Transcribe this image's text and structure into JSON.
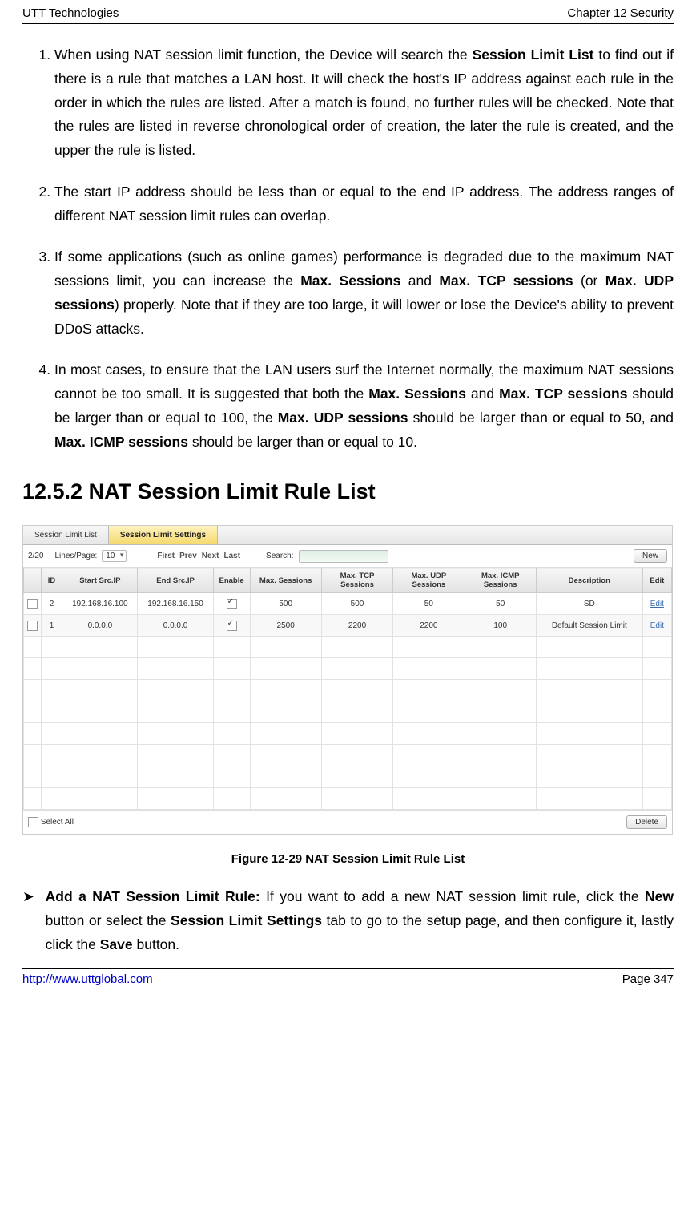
{
  "header": {
    "left": "UTT Technologies",
    "right": "Chapter 12 Security"
  },
  "list_items": {
    "i1_a": "When using NAT session limit function, the Device will search the ",
    "i1_b": "Session Limit List",
    "i1_c": " to find out if there is a rule that matches a LAN host. It will check the host's IP address against each rule in the order in which the rules are listed. After a match is found, no further rules will be checked. Note that the rules are listed in reverse chronological order of creation, the later the rule is created, and the upper the rule is listed.",
    "i2": "The start IP address should be less than or equal to the end IP address. The address ranges of different NAT session limit rules can overlap.",
    "i3_a": "If some applications (such as online games) performance is degraded due to the maximum NAT sessions limit, you can increase the ",
    "i3_b": "Max. Sessions",
    "i3_c": " and ",
    "i3_d": "Max. TCP sessions",
    "i3_e": " (or ",
    "i3_f": "Max. UDP sessions",
    "i3_g": ") properly. Note that if they are too large, it will lower or lose the Device's ability to prevent DDoS attacks.",
    "i4_a": "In most cases, to ensure that the LAN users surf the Internet normally, the maximum NAT sessions cannot be too small. It is suggested that both the ",
    "i4_b": "Max. Sessions",
    "i4_c": " and ",
    "i4_d": "Max. TCP sessions",
    "i4_e": " should be larger than or equal to 100, the ",
    "i4_f": "Max. UDP sessions",
    "i4_g": " should be larger than or equal to 50, and ",
    "i4_h": "Max. ICMP sessions",
    "i4_i": " should be larger than or equal to 10."
  },
  "section_heading": "12.5.2  NAT Session Limit Rule List",
  "mock": {
    "tabs": {
      "t1": "Session Limit List",
      "t2": "Session Limit Settings"
    },
    "toolbar": {
      "count": "2/20",
      "lines_label": "Lines/Page:",
      "lines_value": "10",
      "first": "First",
      "prev": "Prev",
      "next": "Next",
      "last": "Last",
      "search_label": "Search:",
      "new_btn": "New"
    },
    "cols": {
      "id": "ID",
      "start": "Start Src.IP",
      "end": "End Src.IP",
      "enable": "Enable",
      "max": "Max. Sessions",
      "tcp": "Max. TCP Sessions",
      "udp": "Max. UDP Sessions",
      "icmp": "Max. ICMP Sessions",
      "desc": "Description",
      "edit": "Edit"
    },
    "rows": [
      {
        "id": "2",
        "start": "192.168.16.100",
        "end": "192.168.16.150",
        "max": "500",
        "tcp": "500",
        "udp": "50",
        "icmp": "50",
        "desc": "SD",
        "edit": "Edit"
      },
      {
        "id": "1",
        "start": "0.0.0.0",
        "end": "0.0.0.0",
        "max": "2500",
        "tcp": "2200",
        "udp": "2200",
        "icmp": "100",
        "desc": "Default Session Limit",
        "edit": "Edit"
      }
    ],
    "footer": {
      "select_all": "Select All",
      "delete_btn": "Delete"
    }
  },
  "figure_caption": "Figure 12-29 NAT Session Limit Rule List",
  "bullet": {
    "marker": "➤",
    "a": "Add a NAT Session Limit Rule:",
    "b": " If you want to add a new NAT session limit rule, click the ",
    "c": "New",
    "d": " button or select the ",
    "e": "Session Limit Settings",
    "f": " tab to go to the setup page, and then configure it, lastly click the ",
    "g": "Save",
    "h": " button."
  },
  "footer": {
    "url": "http://www.uttglobal.com",
    "page": "Page 347"
  }
}
